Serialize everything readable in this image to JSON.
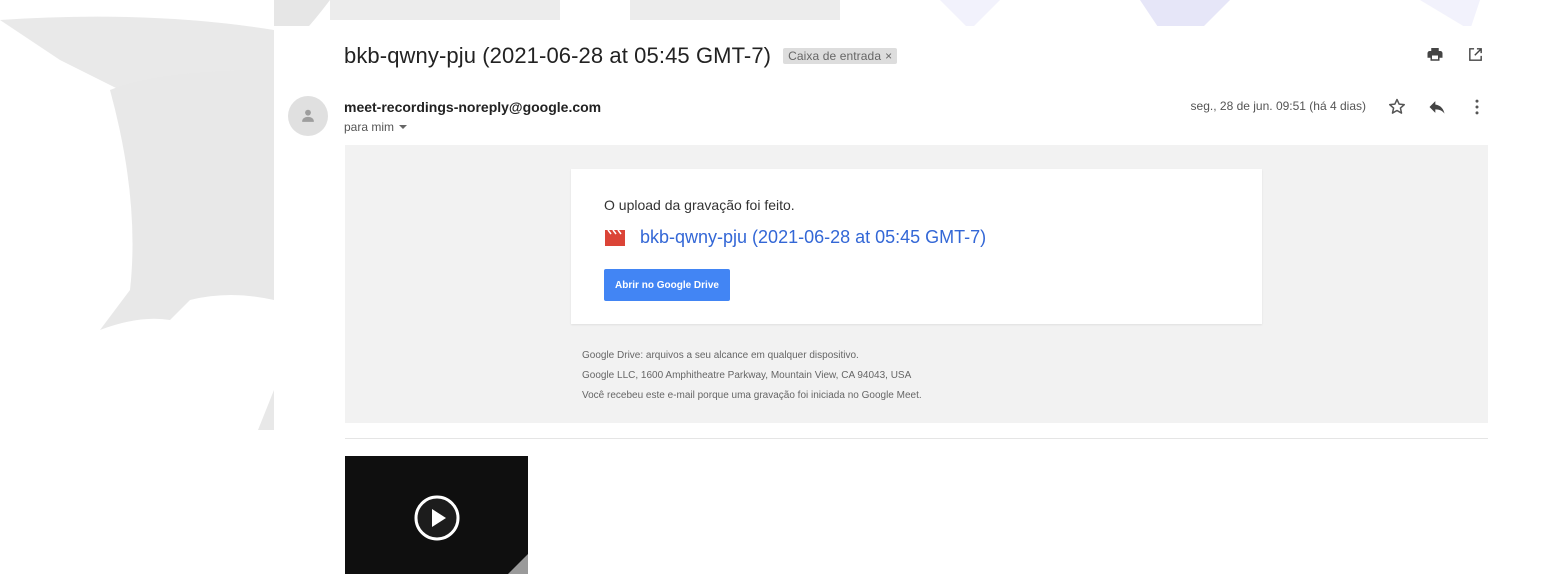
{
  "email": {
    "subject": "bkb-qwny-pju (2021-06-28 at 05:45 GMT-7)",
    "label": "Caixa de entrada",
    "label_remove": "×",
    "sender": "meet-recordings-noreply@google.com",
    "to": "para mim",
    "date": "seg., 28 de jun. 09:51 (há 4 dias)"
  },
  "body": {
    "intro": "O upload da gravação foi feito.",
    "recording_link": "bkb-qwny-pju (2021-06-28 at 05:45 GMT-7)",
    "open_button": "Abrir no Google Drive",
    "footer": [
      "Google Drive: arquivos a seu alcance em qualquer dispositivo.",
      "Google LLC, 1600 Amphitheatre Parkway, Mountain View, CA 94043, USA",
      "Você recebeu este e-mail porque uma gravação foi iniciada no Google Meet."
    ]
  },
  "icons": {
    "print": "print-icon",
    "new_window": "open-in-new-window-icon",
    "star": "star-icon",
    "reply": "reply-icon",
    "more": "more-vert-icon",
    "avatar": "person-icon",
    "video": "video-clapper-icon",
    "play": "play-icon"
  },
  "colors": {
    "link": "#3367d6",
    "button": "#4285f4",
    "clapper": "#db4437",
    "body_bg": "#f2f2f2"
  }
}
